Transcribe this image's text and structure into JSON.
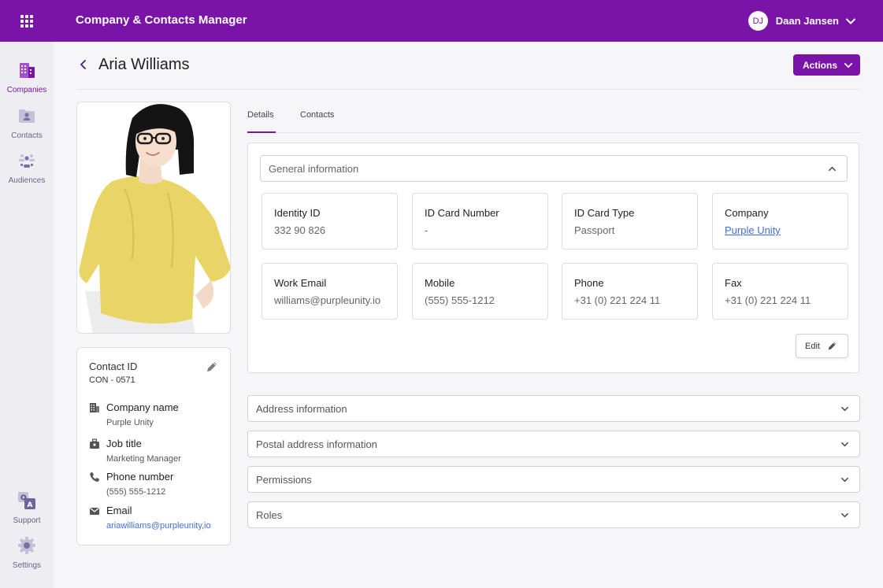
{
  "app": {
    "title": "Company & Contacts Manager",
    "accent": "#7a14a8"
  },
  "user": {
    "initials": "DJ",
    "name": "Daan Jansen"
  },
  "sidebar": {
    "items": [
      {
        "label": "Companies",
        "icon": "companies-icon",
        "active": true
      },
      {
        "label": "Contacts",
        "icon": "contacts-icon",
        "active": false
      },
      {
        "label": "Audiences",
        "icon": "audiences-icon",
        "active": false
      }
    ],
    "bottom": [
      {
        "label": "Support",
        "icon": "support-icon"
      },
      {
        "label": "Settings",
        "icon": "settings-icon"
      }
    ]
  },
  "page": {
    "title": "Aria Williams",
    "actions_label": "Actions"
  },
  "profile": {
    "contact_id_label": "Contact ID",
    "contact_id": "CON - 0571",
    "rows": [
      {
        "label": "Company name",
        "value": "Purple Unity",
        "icon": "building-icon"
      },
      {
        "label": "Job title",
        "value": "Marketing Manager",
        "icon": "briefcase-icon"
      },
      {
        "label": "Phone number",
        "value": "(555) 555-1212",
        "icon": "phone-icon"
      },
      {
        "label": "Email",
        "value": "ariawilliams@purpleunity,io",
        "icon": "mail-icon"
      }
    ]
  },
  "tabs": [
    {
      "label": "Details",
      "active": true
    },
    {
      "label": "Contacts",
      "active": false
    }
  ],
  "general": {
    "title": "General information",
    "fields": [
      {
        "label": "Identity ID",
        "value": "332 90 826"
      },
      {
        "label": "ID Card Number",
        "value": "-"
      },
      {
        "label": "ID Card Type",
        "value": "Passport"
      },
      {
        "label": "Company",
        "value": "Purple Unity",
        "link": true
      },
      {
        "label": "Work Email",
        "value": "williams@purpleunity.io"
      },
      {
        "label": "Mobile",
        "value": "(555) 555-1212"
      },
      {
        "label": "Phone",
        "value": "+31 (0) 221 224 11"
      },
      {
        "label": "Fax",
        "value": "+31 (0) 221 224 11"
      }
    ],
    "edit_label": "Edit"
  },
  "sections": [
    {
      "title": "Address information"
    },
    {
      "title": "Postal address information"
    },
    {
      "title": "Permissions"
    },
    {
      "title": "Roles"
    }
  ]
}
